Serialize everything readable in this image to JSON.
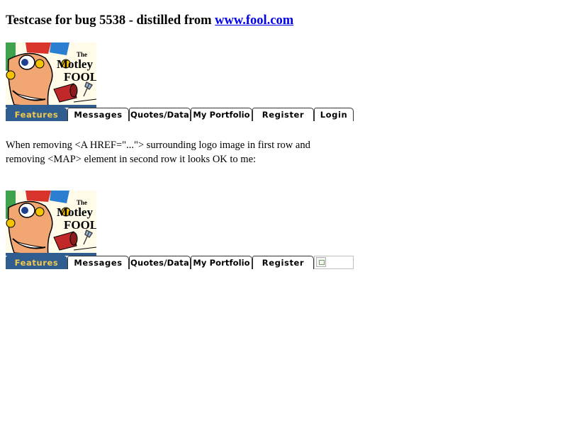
{
  "heading": {
    "text": "Testcase for bug 5538 - distilled from",
    "link_text": "www.fool.com"
  },
  "logo": {
    "label_the": "The",
    "label_motley": "Motley",
    "label_fool": "FOOL"
  },
  "tabs": [
    "Features",
    "Messages",
    "Quotes/Data",
    "My Portfolio",
    "Register",
    "Login"
  ],
  "paragraph": "When removing <A HREF=\"...\"> surrounding logo image in first row and removing <MAP> element in second row it looks OK to me:",
  "colors": {
    "active_tab_bg": "#2f5d8f",
    "active_tab_text": "#f2c94c",
    "link": "#0000ee"
  }
}
